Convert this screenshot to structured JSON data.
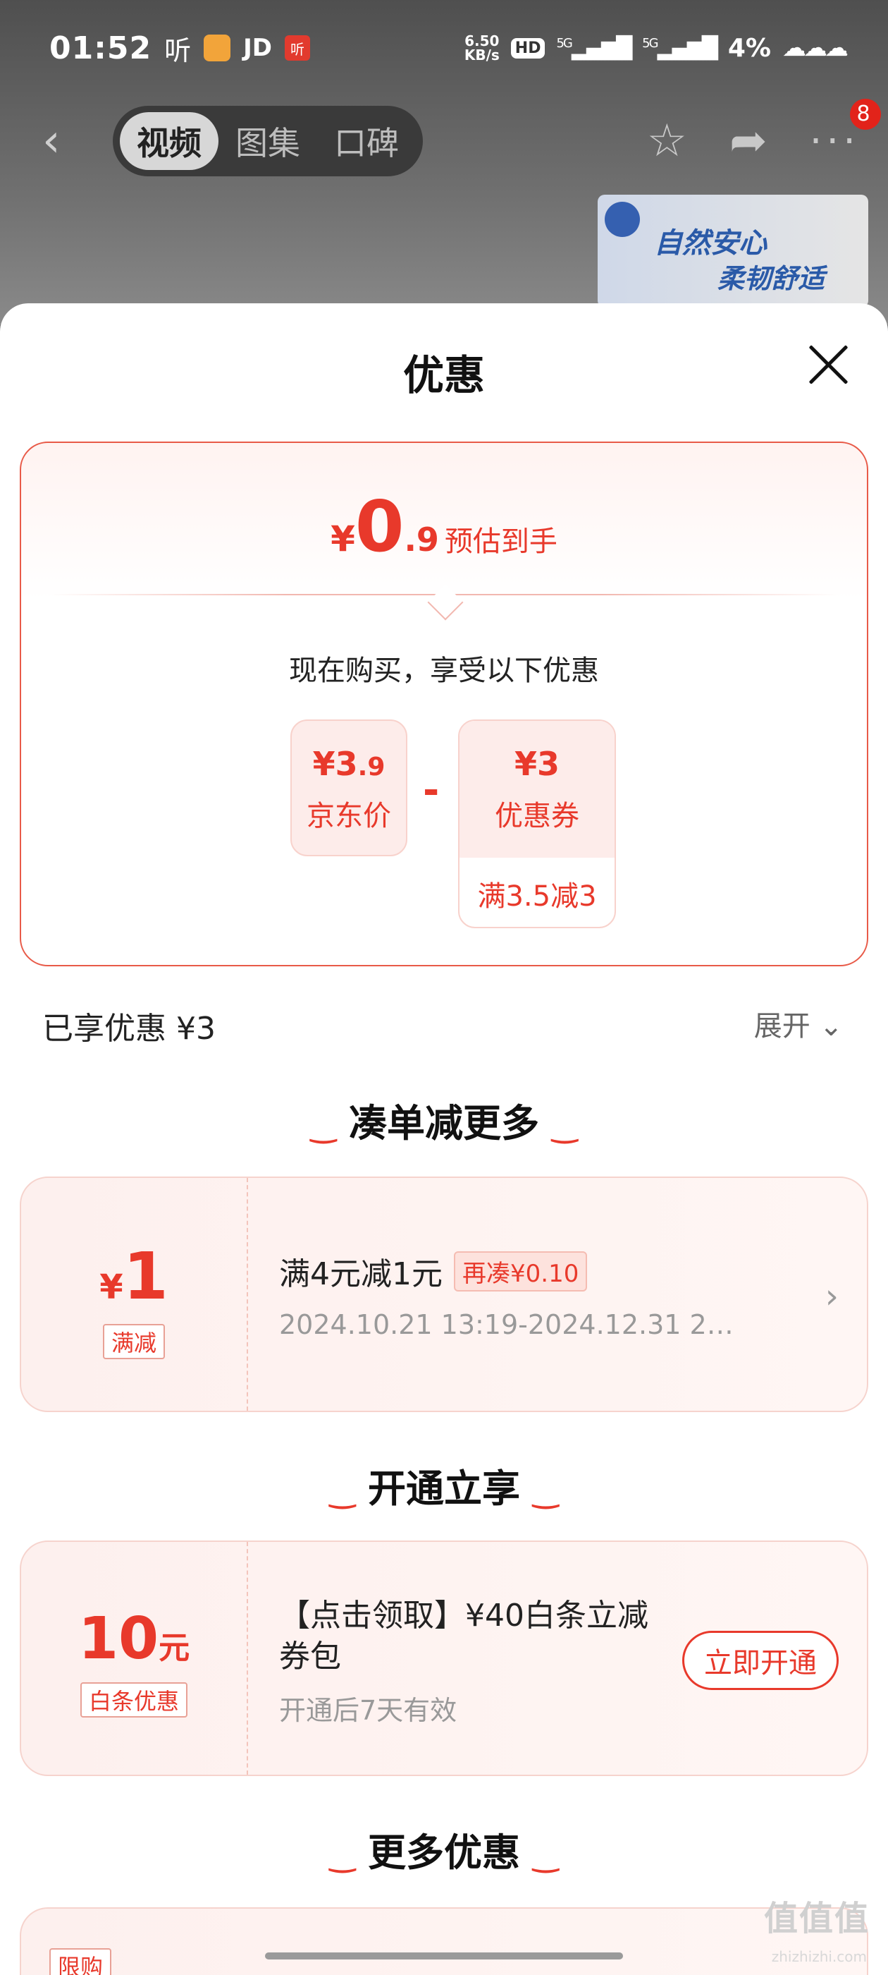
{
  "status_bar": {
    "time": "01:52",
    "listen_label": "听",
    "jd_label": "JD",
    "red_label": "听",
    "net_speed_top": "6.50",
    "net_speed_bottom": "KB/s",
    "hd_label": "HD",
    "signal1": "5G",
    "signal2": "5G",
    "battery": "4%"
  },
  "nav": {
    "tabs": [
      {
        "label": "视频",
        "active": true
      },
      {
        "label": "图集",
        "active": false
      },
      {
        "label": "口碑",
        "active": false
      }
    ],
    "badge_count": "8"
  },
  "ad": {
    "line1": "自然安心",
    "line2": "柔韧舒适"
  },
  "sheet": {
    "title": "优惠",
    "summary": {
      "currency": "¥",
      "final_int": "0",
      "final_dec": ".9",
      "final_label": "预估到手",
      "buy_text": "现在购买，享受以下优惠",
      "price_amount_int": "¥3",
      "price_amount_dec": ".9",
      "price_label": "京东价",
      "minus": "-",
      "coupon_amount": "¥3",
      "coupon_label": "优惠券",
      "coupon_condition": "满3.5减3"
    },
    "enjoyed": "已享优惠 ¥3",
    "expand": "展开",
    "sections": [
      {
        "title": "凑单减更多"
      },
      {
        "title": "开通立享"
      },
      {
        "title": "更多优惠"
      }
    ],
    "promo1": {
      "currency": "¥",
      "value": "1",
      "tag": "满减",
      "title": "满4元减1元",
      "pill": "再凑¥0.10",
      "period": "2024.10.21 13:19-2024.12.31 2…"
    },
    "promo2": {
      "value": "10",
      "unit": "元",
      "tag": "白条优惠",
      "title": "【点击领取】¥40白条立减券包",
      "subtitle": "开通后7天有效",
      "button": "立即开通"
    },
    "promo3": {
      "tag": "限购"
    }
  },
  "watermark": {
    "main": "值值值",
    "sub": "zhizhizhi.com"
  },
  "colors": {
    "accent": "#e8392b",
    "card_border": "#e85a48",
    "backdrop": "#6f6f6f"
  }
}
